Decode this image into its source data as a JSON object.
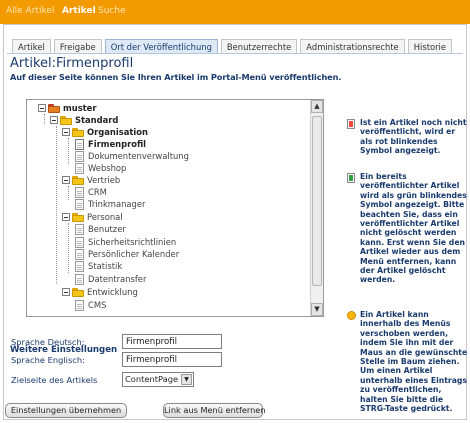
{
  "topnav": {
    "items": [
      "Alle Artikel",
      "Artikel",
      "Suche"
    ]
  },
  "tabs": [
    "Artikel",
    "Freigabe",
    "Ort der Veröffentlichung",
    "Benutzerrechte",
    "Administrationsrechte",
    "Historie"
  ],
  "active_tab": "Ort der Veröffentlichung",
  "title": "Artikel:Firmenprofil",
  "subtitle": "Auf dieser Seite können Sie Ihren Artikel im Portal-Menü veröffentlichen.",
  "tree": {
    "nodes": [
      {
        "label": "muster",
        "type": "root"
      },
      {
        "label": "Standard",
        "type": "folder"
      },
      {
        "label": "Organisation",
        "type": "folder"
      },
      {
        "label": "Firmenprofil",
        "type": "page"
      },
      {
        "label": "Dokumentenverwaltung",
        "type": "page"
      },
      {
        "label": "Webshop",
        "type": "page"
      },
      {
        "label": "Vertrieb",
        "type": "folder"
      },
      {
        "label": "CRM",
        "type": "page"
      },
      {
        "label": "Trinkmanager",
        "type": "page"
      },
      {
        "label": "Personal",
        "type": "folder"
      },
      {
        "label": "Benutzer",
        "type": "page"
      },
      {
        "label": "Sicherheitsrichtlinien",
        "type": "page"
      },
      {
        "label": "Persönlicher Kalender",
        "type": "page"
      },
      {
        "label": "Statistik",
        "type": "page"
      },
      {
        "label": "Datentransfer",
        "type": "page"
      },
      {
        "label": "Entwicklung",
        "type": "folder"
      },
      {
        "label": "CMS",
        "type": "page"
      }
    ]
  },
  "settings": {
    "heading": "Weitere Einstellungen",
    "label_de": "Sprache Deutsch:",
    "value_de": "Firmenprofil",
    "label_en": "Sprache Englisch:",
    "value_en": "Firmenprofil",
    "label_target": "Zielseite des Artikels",
    "target_value": "ContentPage"
  },
  "buttons": {
    "apply": "Einstellungen übernehmen",
    "remove_link": "Link aus Menü entfernen"
  },
  "info": {
    "red": "Ist ein Artikel noch nicht veröffentlicht, wird er als rot blinkendes Symbol angezeigt.",
    "green": "Ein bereits veröffentlichter Artikel wird als grün blinkendes Symbol angezeigt. Bitte beachten Sie, dass ein veröffentlichter Artikel nicht gelöscht werden kann. Erst wenn Sie den Artikel wieder aus dem Menü entfernen, kann der Artikel gelöscht werden.",
    "tip": "Ein Artikel kann innerhalb des Menüs verschoben werden, indem Sie ihn mit der Maus an die gewünschte Stelle im Baum ziehen. Um einen Artikel unterhalb eines Eintrags zu veröffentlichen, halten Sie bitte die STRG-Taste gedrückt."
  },
  "colors": {
    "topbar": "#f29a00",
    "heading": "#1a3b6e"
  }
}
